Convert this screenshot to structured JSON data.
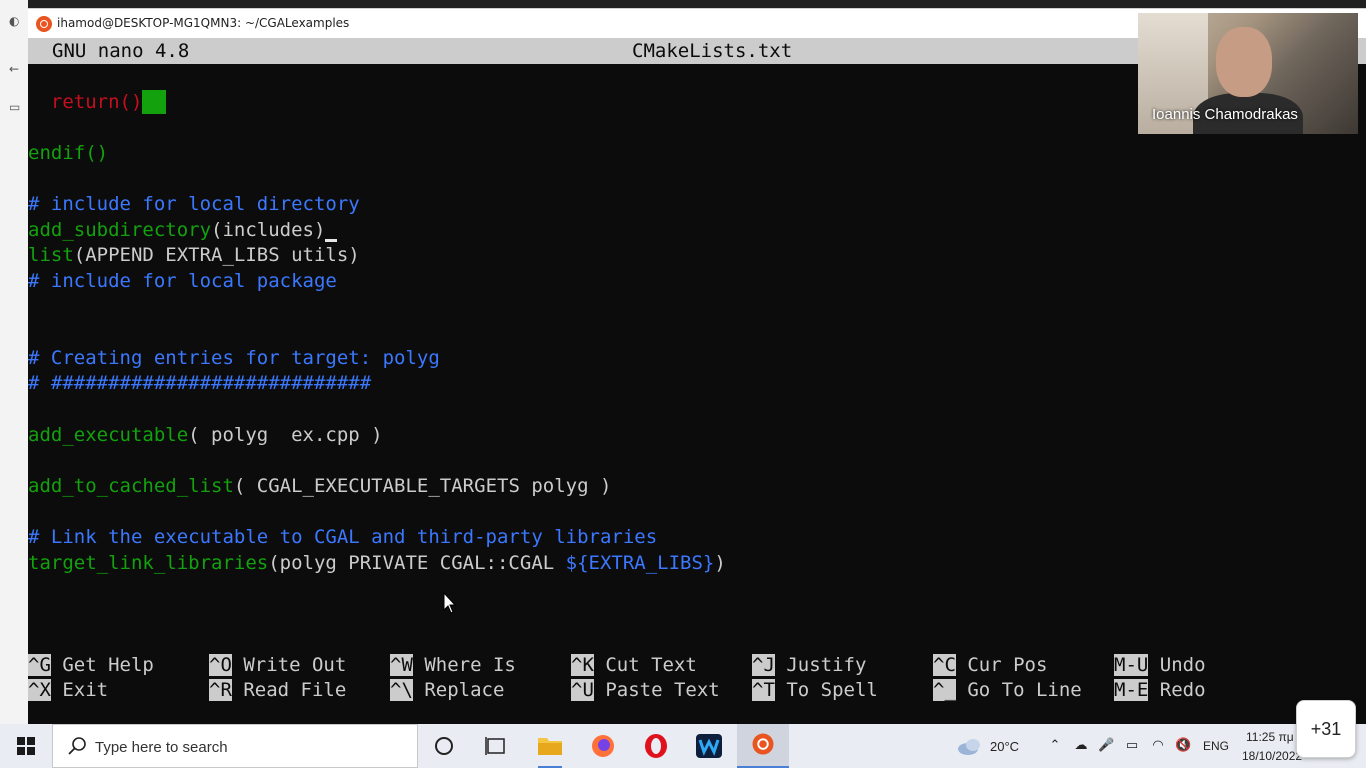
{
  "window": {
    "title": "ihamod@DESKTOP-MG1QMN3: ~/CGALexamples"
  },
  "nano": {
    "version": "GNU nano 4.8",
    "filename": "CMakeLists.txt"
  },
  "code": {
    "l1": "return()",
    "l2": "endif()",
    "l3": "# include for local directory",
    "l4a": "add_subdirectory",
    "l4b": "(includes)",
    "l5a": "list",
    "l5b": "(APPEND EXTRA_LIBS utils)",
    "l6": "# include for local package",
    "l7": "# Creating entries for target: polyg",
    "l8": "# ############################",
    "l9a": "add_executable",
    "l9b": "( polyg  ex.cpp )",
    "l10a": "add_to_cached_list",
    "l10b": "( CGAL_EXECUTABLE_TARGETS polyg )",
    "l11": "# Link the executable to CGAL and third-party libraries",
    "l12a": "target_link_libraries",
    "l12b": "(polyg PRIVATE CGAL::CGAL ",
    "l12c": "${EXTRA_LIBS}",
    "l12d": ")"
  },
  "shortcuts": [
    {
      "key": "^G",
      "label": "Get Help"
    },
    {
      "key": "^X",
      "label": "Exit"
    },
    {
      "key": "^O",
      "label": "Write Out"
    },
    {
      "key": "^R",
      "label": "Read File"
    },
    {
      "key": "^W",
      "label": "Where Is"
    },
    {
      "key": "^\\",
      "label": "Replace"
    },
    {
      "key": "^K",
      "label": "Cut Text"
    },
    {
      "key": "^U",
      "label": "Paste Text"
    },
    {
      "key": "^J",
      "label": "Justify"
    },
    {
      "key": "^T",
      "label": "To Spell"
    },
    {
      "key": "^C",
      "label": "Cur Pos"
    },
    {
      "key": "^_",
      "label": "Go To Line"
    },
    {
      "key": "M-U",
      "label": "Undo"
    },
    {
      "key": "M-E",
      "label": "Redo"
    }
  ],
  "webcam": {
    "name": "Ioannis Chamodrakas"
  },
  "taskbar": {
    "search_placeholder": "Type here to search",
    "weather": "20°C",
    "language": "ENG",
    "time": "11:25 πμ",
    "date": "18/10/2022"
  },
  "notification": {
    "count": "+31"
  },
  "colors": {
    "terminal_bg": "#0c0c0c",
    "keyword_green": "#13a10e",
    "comment_blue": "#3b78ff",
    "return_red": "#c50f1f"
  }
}
